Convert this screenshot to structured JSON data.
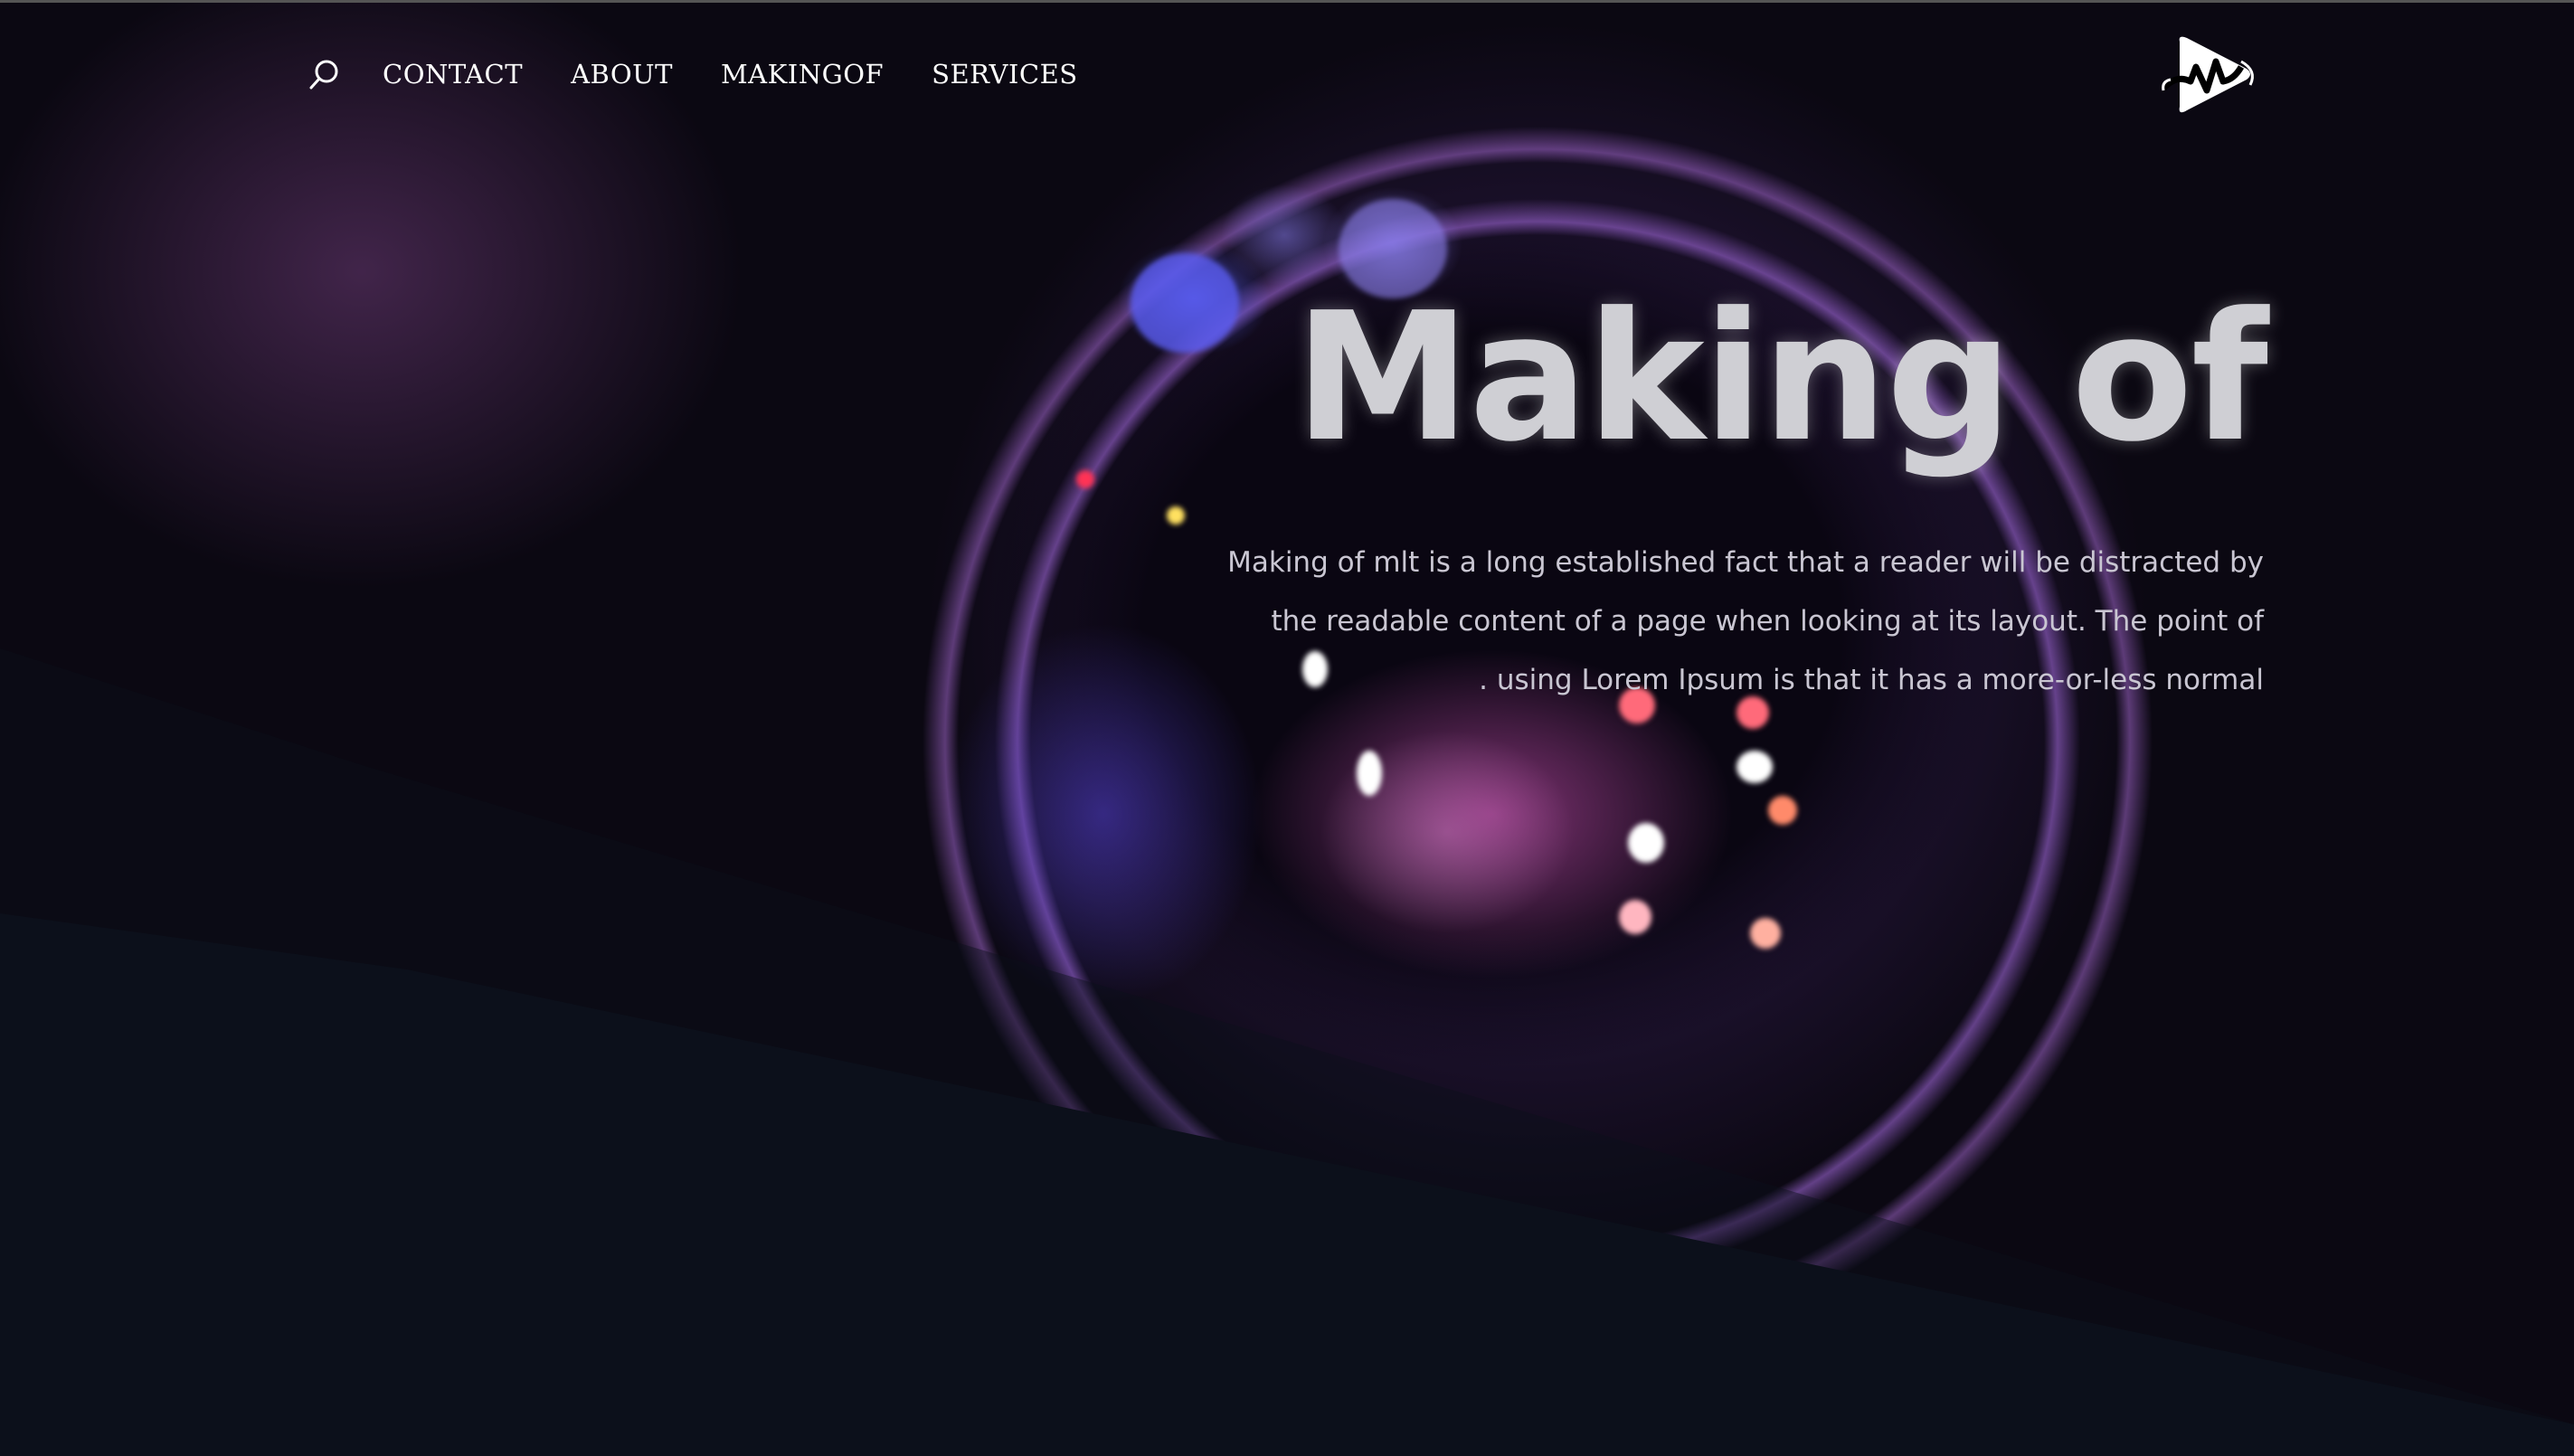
{
  "nav": {
    "search_icon": "search-icon",
    "items": [
      {
        "label": "CONTACT"
      },
      {
        "label": "ABOUT"
      },
      {
        "label": "MAKINGOF"
      },
      {
        "label": "SERVICES"
      }
    ]
  },
  "logo": {
    "icon": "play-wave-logo"
  },
  "hero": {
    "title": "Making of",
    "lines": [
      "Making of mlt is a long established fact that a reader will be distracted by",
      "the readable content of a page when looking at its layout. The point of",
      ". using Lorem Ipsum is that it has a more-or-less normal"
    ]
  },
  "colors": {
    "background": "#0c101b",
    "text": "#ffffff",
    "title": "#cfcfd4"
  }
}
